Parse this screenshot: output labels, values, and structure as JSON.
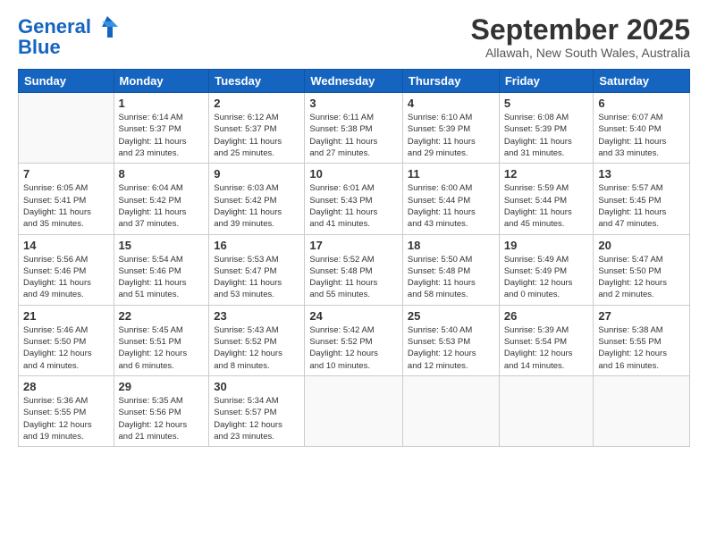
{
  "logo": {
    "line1": "General",
    "line2": "Blue"
  },
  "title": "September 2025",
  "subtitle": "Allawah, New South Wales, Australia",
  "weekdays": [
    "Sunday",
    "Monday",
    "Tuesday",
    "Wednesday",
    "Thursday",
    "Friday",
    "Saturday"
  ],
  "weeks": [
    [
      {
        "day": "",
        "detail": ""
      },
      {
        "day": "1",
        "detail": "Sunrise: 6:14 AM\nSunset: 5:37 PM\nDaylight: 11 hours\nand 23 minutes."
      },
      {
        "day": "2",
        "detail": "Sunrise: 6:12 AM\nSunset: 5:37 PM\nDaylight: 11 hours\nand 25 minutes."
      },
      {
        "day": "3",
        "detail": "Sunrise: 6:11 AM\nSunset: 5:38 PM\nDaylight: 11 hours\nand 27 minutes."
      },
      {
        "day": "4",
        "detail": "Sunrise: 6:10 AM\nSunset: 5:39 PM\nDaylight: 11 hours\nand 29 minutes."
      },
      {
        "day": "5",
        "detail": "Sunrise: 6:08 AM\nSunset: 5:39 PM\nDaylight: 11 hours\nand 31 minutes."
      },
      {
        "day": "6",
        "detail": "Sunrise: 6:07 AM\nSunset: 5:40 PM\nDaylight: 11 hours\nand 33 minutes."
      }
    ],
    [
      {
        "day": "7",
        "detail": "Sunrise: 6:05 AM\nSunset: 5:41 PM\nDaylight: 11 hours\nand 35 minutes."
      },
      {
        "day": "8",
        "detail": "Sunrise: 6:04 AM\nSunset: 5:42 PM\nDaylight: 11 hours\nand 37 minutes."
      },
      {
        "day": "9",
        "detail": "Sunrise: 6:03 AM\nSunset: 5:42 PM\nDaylight: 11 hours\nand 39 minutes."
      },
      {
        "day": "10",
        "detail": "Sunrise: 6:01 AM\nSunset: 5:43 PM\nDaylight: 11 hours\nand 41 minutes."
      },
      {
        "day": "11",
        "detail": "Sunrise: 6:00 AM\nSunset: 5:44 PM\nDaylight: 11 hours\nand 43 minutes."
      },
      {
        "day": "12",
        "detail": "Sunrise: 5:59 AM\nSunset: 5:44 PM\nDaylight: 11 hours\nand 45 minutes."
      },
      {
        "day": "13",
        "detail": "Sunrise: 5:57 AM\nSunset: 5:45 PM\nDaylight: 11 hours\nand 47 minutes."
      }
    ],
    [
      {
        "day": "14",
        "detail": "Sunrise: 5:56 AM\nSunset: 5:46 PM\nDaylight: 11 hours\nand 49 minutes."
      },
      {
        "day": "15",
        "detail": "Sunrise: 5:54 AM\nSunset: 5:46 PM\nDaylight: 11 hours\nand 51 minutes."
      },
      {
        "day": "16",
        "detail": "Sunrise: 5:53 AM\nSunset: 5:47 PM\nDaylight: 11 hours\nand 53 minutes."
      },
      {
        "day": "17",
        "detail": "Sunrise: 5:52 AM\nSunset: 5:48 PM\nDaylight: 11 hours\nand 55 minutes."
      },
      {
        "day": "18",
        "detail": "Sunrise: 5:50 AM\nSunset: 5:48 PM\nDaylight: 11 hours\nand 58 minutes."
      },
      {
        "day": "19",
        "detail": "Sunrise: 5:49 AM\nSunset: 5:49 PM\nDaylight: 12 hours\nand 0 minutes."
      },
      {
        "day": "20",
        "detail": "Sunrise: 5:47 AM\nSunset: 5:50 PM\nDaylight: 12 hours\nand 2 minutes."
      }
    ],
    [
      {
        "day": "21",
        "detail": "Sunrise: 5:46 AM\nSunset: 5:50 PM\nDaylight: 12 hours\nand 4 minutes."
      },
      {
        "day": "22",
        "detail": "Sunrise: 5:45 AM\nSunset: 5:51 PM\nDaylight: 12 hours\nand 6 minutes."
      },
      {
        "day": "23",
        "detail": "Sunrise: 5:43 AM\nSunset: 5:52 PM\nDaylight: 12 hours\nand 8 minutes."
      },
      {
        "day": "24",
        "detail": "Sunrise: 5:42 AM\nSunset: 5:52 PM\nDaylight: 12 hours\nand 10 minutes."
      },
      {
        "day": "25",
        "detail": "Sunrise: 5:40 AM\nSunset: 5:53 PM\nDaylight: 12 hours\nand 12 minutes."
      },
      {
        "day": "26",
        "detail": "Sunrise: 5:39 AM\nSunset: 5:54 PM\nDaylight: 12 hours\nand 14 minutes."
      },
      {
        "day": "27",
        "detail": "Sunrise: 5:38 AM\nSunset: 5:55 PM\nDaylight: 12 hours\nand 16 minutes."
      }
    ],
    [
      {
        "day": "28",
        "detail": "Sunrise: 5:36 AM\nSunset: 5:55 PM\nDaylight: 12 hours\nand 19 minutes."
      },
      {
        "day": "29",
        "detail": "Sunrise: 5:35 AM\nSunset: 5:56 PM\nDaylight: 12 hours\nand 21 minutes."
      },
      {
        "day": "30",
        "detail": "Sunrise: 5:34 AM\nSunset: 5:57 PM\nDaylight: 12 hours\nand 23 minutes."
      },
      {
        "day": "",
        "detail": ""
      },
      {
        "day": "",
        "detail": ""
      },
      {
        "day": "",
        "detail": ""
      },
      {
        "day": "",
        "detail": ""
      }
    ]
  ]
}
